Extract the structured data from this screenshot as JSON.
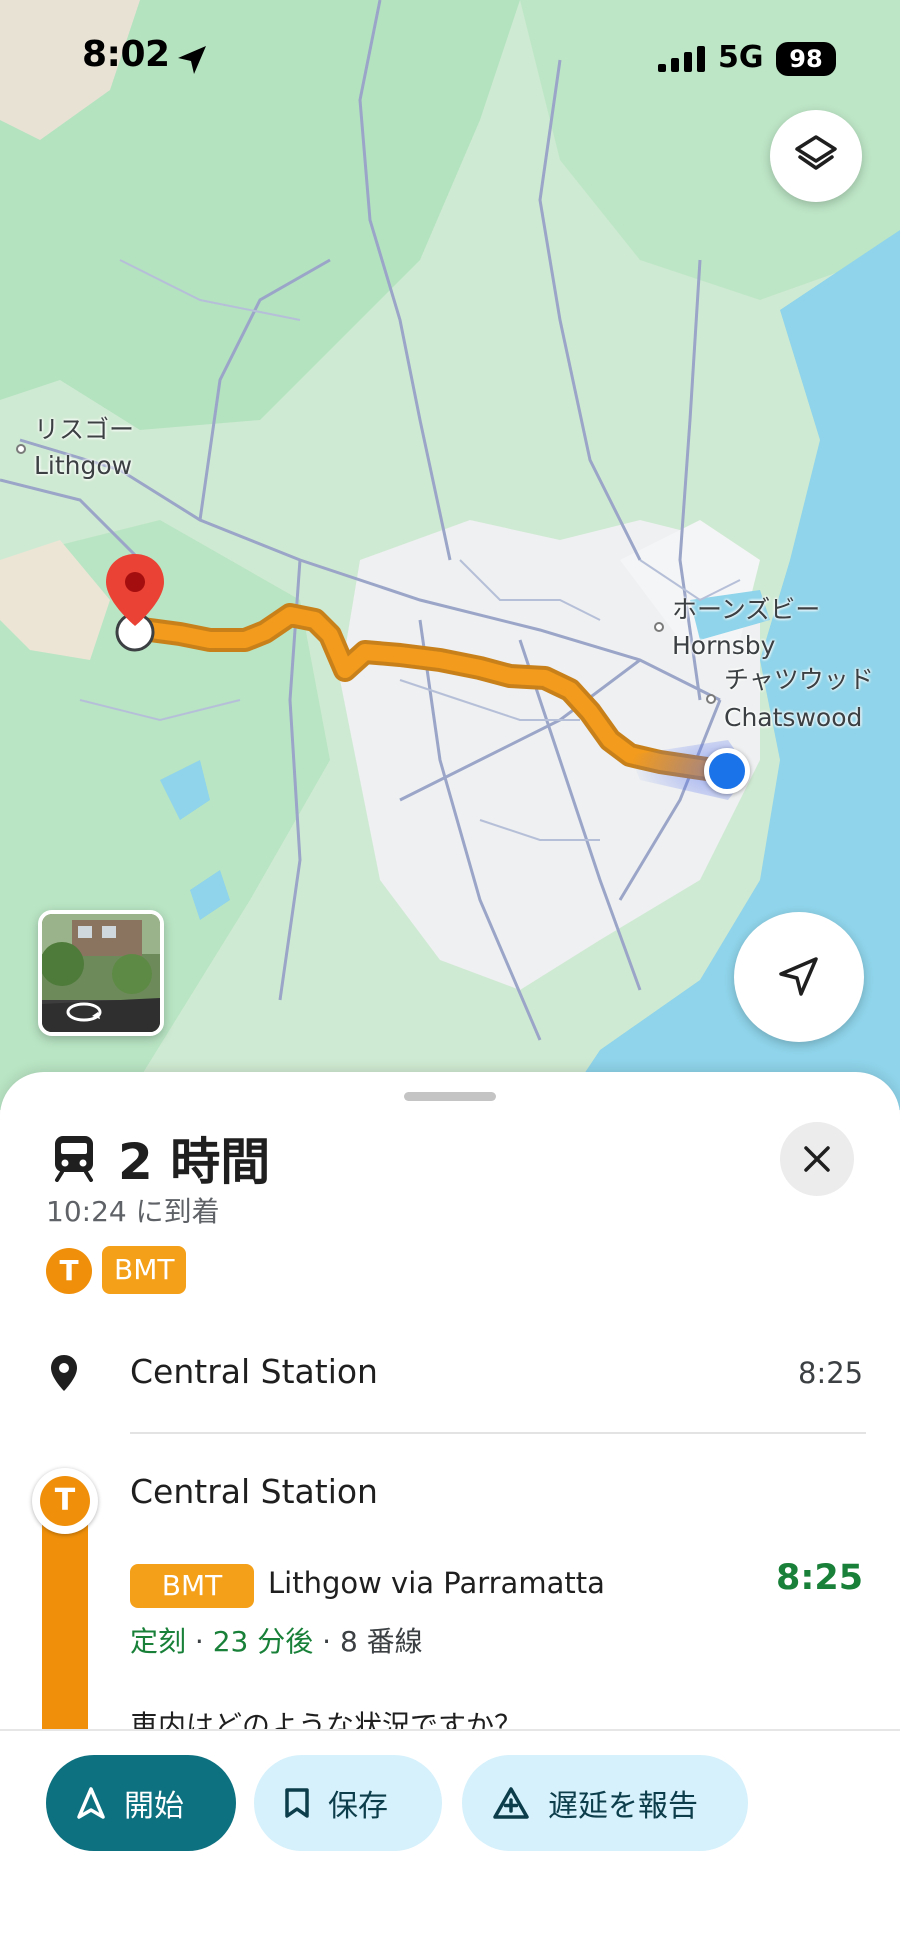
{
  "status_bar": {
    "time": "8:02",
    "network": "5G",
    "battery": "98"
  },
  "map": {
    "labels": {
      "lithgow_ja": "リスゴー",
      "lithgow_en": "Lithgow",
      "hornsby_ja": "ホーンズビー",
      "hornsby_en": "Hornsby",
      "chatswood_ja": "チャツウッド",
      "chatswood_en": "Chatswood"
    },
    "colors": {
      "land": "#d6efd6",
      "forest": "#a6dfb7",
      "water": "#8fd4ea",
      "urban": "#f1f3f4",
      "route": "#f29b1d",
      "route_outline": "#c8811a",
      "origin_dot": "#1a73e8",
      "destination_pin": "#ea4335"
    }
  },
  "sheet": {
    "mode_icon": "train-icon",
    "duration": "2 時間",
    "arrival": "10:24 に到着",
    "summary": {
      "agency_badge": "T",
      "line_badge": "BMT"
    },
    "origin": {
      "name": "Central Station",
      "time": "8:25"
    },
    "stop": {
      "badge": "T",
      "name": "Central Station"
    },
    "leg": {
      "line": "BMT",
      "headsign": "Lithgow via Parramatta",
      "depart_time": "8:25",
      "status": "定刻",
      "minutes": "23 分後",
      "platform": "8 番線",
      "separator": " · "
    },
    "crowd_question": "車内はどのような状況ですか？"
  },
  "actions": {
    "start": "開始",
    "save": "保存",
    "report": "遅延を報告"
  },
  "colors": {
    "accent_start": "#0e7180",
    "secondary_pill": "#d6f1fb",
    "on_time": "#188038",
    "transit_orange": "#f0900a"
  }
}
